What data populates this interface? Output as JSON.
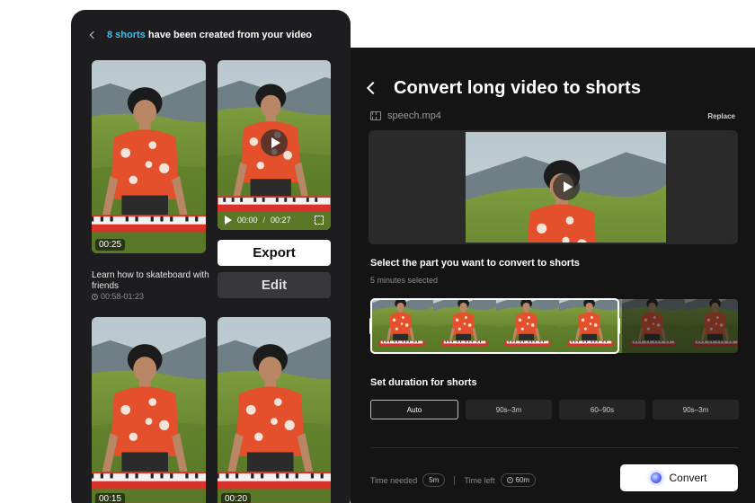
{
  "left_panel": {
    "header_count": "8 shorts",
    "header_rest": "have been created from your video",
    "clips": [
      {
        "duration": "00:25"
      },
      {
        "current": "00:00",
        "total": "00:27"
      },
      {
        "duration": "00:15"
      },
      {
        "duration": "00:20"
      }
    ],
    "export_label": "Export",
    "edit_label": "Edit",
    "caption": "Learn how to skateboard with friends",
    "caption_time": "00:58-01:23"
  },
  "right_panel": {
    "title": "Convert long video to shorts",
    "file_name": "speech.mp4",
    "replace_label": "Replace",
    "select_title": "Select the part you want to convert to shorts",
    "selected_info": "5 minutes selected",
    "duration_title": "Set duration for shorts",
    "duration_options": [
      "Auto",
      "90s–3m",
      "60–90s",
      "90s–3m"
    ],
    "time_needed_label": "Time needed",
    "time_needed_value": "5m",
    "time_left_label": "Time left",
    "time_left_value": "60m",
    "convert_label": "Convert"
  },
  "colors": {
    "accent": "#3fc0ee",
    "panel_dark": "#141414",
    "phone_dark": "#1d1d1f"
  }
}
